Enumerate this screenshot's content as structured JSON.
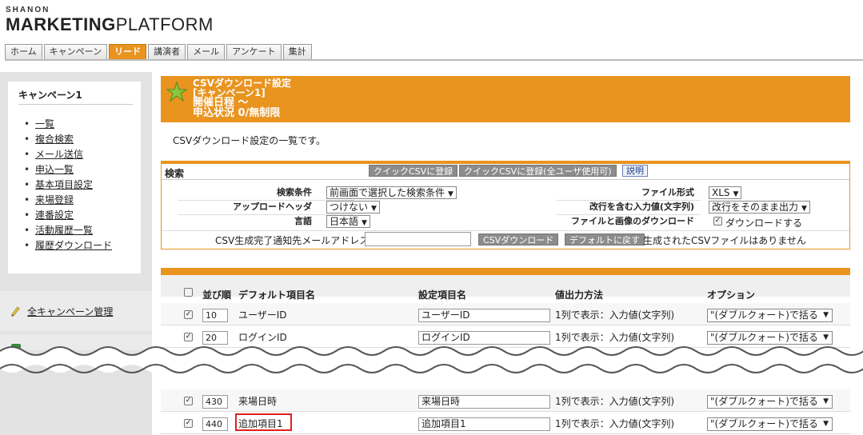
{
  "brand": {
    "top": "SHANON",
    "main_bold": "MARKETING",
    "main_rest": "PLATFORM"
  },
  "tabs": [
    {
      "label": "ホーム"
    },
    {
      "label": "キャンペーン"
    },
    {
      "label": "リード",
      "active": true
    },
    {
      "label": "講演者"
    },
    {
      "label": "メール"
    },
    {
      "label": "アンケート"
    },
    {
      "label": "集計"
    }
  ],
  "sidebar": {
    "title": "キャンペーン1",
    "items": [
      {
        "label": "一覧"
      },
      {
        "label": "複合検索"
      },
      {
        "label": "メール送信"
      },
      {
        "label": "申込一覧"
      },
      {
        "label": "基本項目設定"
      },
      {
        "label": "来場登録"
      },
      {
        "label": "連番設定"
      },
      {
        "label": "活動履歴一覧"
      },
      {
        "label": "履歴ダウンロード"
      }
    ],
    "all_link": "全キャンペーン管理"
  },
  "panel": {
    "line1": "CSVダウンロード設定",
    "line2": "[キャンペーン1]",
    "line3": "開催日程 ～",
    "line4": "申込状況 0/無制限"
  },
  "description": "CSVダウンロード設定の一覧です。",
  "search": {
    "label": "検索",
    "btn_quick": "クイックCSVに登録",
    "btn_quick_all": "クイックCSVに登録(全ユーザ使用可)",
    "btn_help": "説明",
    "cond_label": "検索条件",
    "cond_value": "前画面で選択した検索条件",
    "upload_label": "アップロードヘッダ",
    "upload_value": "つけない",
    "lang_label": "言語",
    "lang_value": "日本語",
    "format_label": "ファイル形式",
    "format_value": "XLS",
    "newline_label": "改行を含む入力値(文字列)",
    "newline_value": "改行をそのまま出力",
    "fileimg_label": "ファイルと画像のダウンロード",
    "fileimg_value": "ダウンロードする",
    "email_label": "CSV生成完了通知先メールアドレス",
    "btn_download": "CSVダウンロード",
    "btn_default": "デフォルトに戻す",
    "status": "生成されたCSVファイルはありません"
  },
  "table": {
    "headers": {
      "order": "並び順",
      "default_name": "デフォルト項目名",
      "setting_name": "設定項目名",
      "output": "値出力方法",
      "option": "オプション"
    },
    "rows": [
      {
        "checked": true,
        "order": "10",
        "default_name": "ユーザーID",
        "setting_name": "ユーザーID",
        "output": "1列で表示：入力値(文字列)",
        "option": "\"(ダブルクォート)で括る"
      },
      {
        "checked": true,
        "order": "20",
        "default_name": "ログインID",
        "setting_name": "ログインID",
        "output": "1列で表示：入力値(文字列)",
        "option": "\"(ダブルクォート)で括る"
      },
      {
        "checked": true,
        "order": "430",
        "default_name": "来場日時",
        "setting_name": "来場日時",
        "output": "1列で表示：入力値(文字列)",
        "option": "\"(ダブルクォート)で括る"
      },
      {
        "checked": true,
        "order": "440",
        "default_name": "追加項目1",
        "setting_name": "追加項目1",
        "output": "1列で表示：入力値(文字列)",
        "option": "\"(ダブルクォート)で括る",
        "highlighted": true
      }
    ]
  },
  "colors": {
    "accent": "#e8941f",
    "highlight": "#e02020",
    "button_gray": "#8c8c8c"
  }
}
